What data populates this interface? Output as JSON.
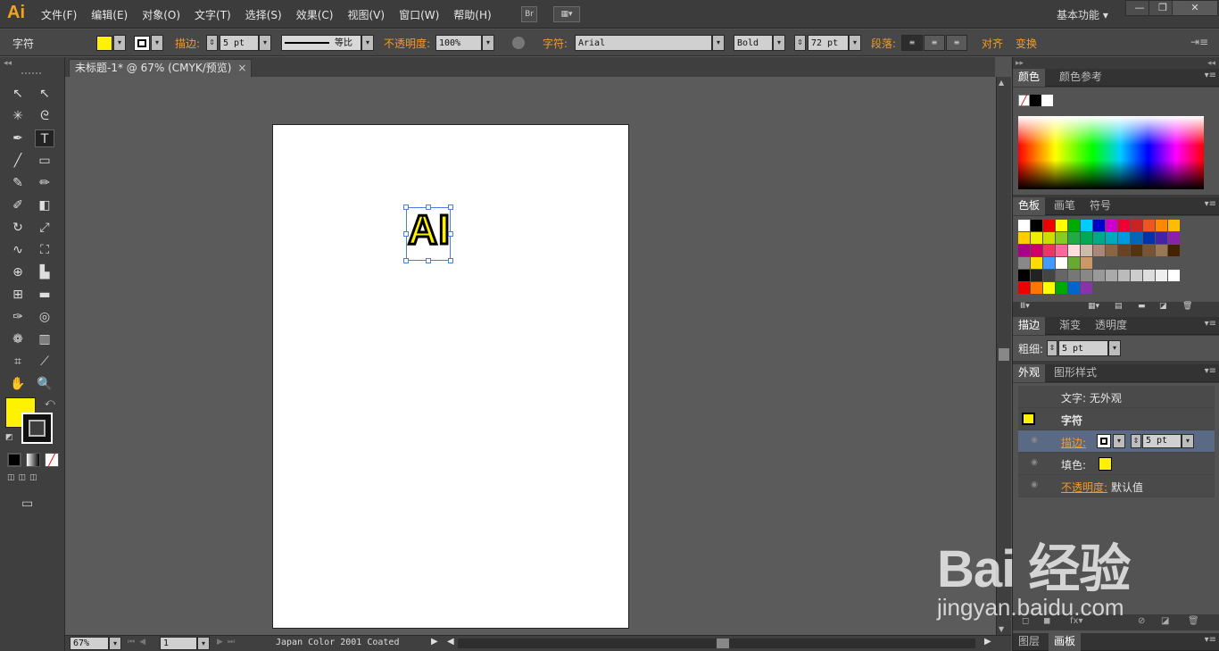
{
  "app": {
    "logo": "Ai"
  },
  "menu": [
    "文件(F)",
    "编辑(E)",
    "对象(O)",
    "文字(T)",
    "选择(S)",
    "效果(C)",
    "视图(V)",
    "窗口(W)",
    "帮助(H)"
  ],
  "menubar": {
    "bridge": "Br",
    "workspace": "基本功能 ▾"
  },
  "window_buttons": {
    "minimize": "—",
    "restore": "❐",
    "close": "✕"
  },
  "control": {
    "type_label": "字符",
    "stroke_label": "描边:",
    "stroke_value": "5 pt",
    "stroke_profile": "等比",
    "opacity_label": "不透明度:",
    "opacity_value": "100%",
    "char_label": "字符:",
    "font": "Arial",
    "style": "Bold",
    "size": "72 pt",
    "para_label": "段落:",
    "align_label": "对齐",
    "transform_label": "变换",
    "fill_color": "#fff200"
  },
  "document": {
    "tab_title": "未标题-1* @ 67% (CMYK/预览)",
    "close": "×",
    "art_text": "AI"
  },
  "status": {
    "zoom": "67%",
    "page": "1",
    "profile": "Japan Color 2001 Coated"
  },
  "panels": {
    "color_tabs": [
      "颜色",
      "颜色参考"
    ],
    "swatch_tabs": [
      "色板",
      "画笔",
      "符号"
    ],
    "stroke_tabs": [
      "描边",
      "渐变",
      "透明度"
    ],
    "weight_label": "粗细:",
    "weight_value": "5 pt",
    "appearance_tabs": [
      "外观",
      "图形样式"
    ],
    "appearance": {
      "header": "文字: 无外观",
      "char": "字符",
      "stroke_label": "描边:",
      "stroke_value": "5 pt",
      "fill_label": "填色:",
      "opacity_label": "不透明度:",
      "opacity_value": "默认值"
    },
    "bottom_tabs": [
      "图层",
      "画板"
    ]
  },
  "watermark": {
    "brand": "Bai 经验",
    "url": "jingyan.baidu.com"
  },
  "swatch_colors": [
    [
      "#fff",
      "#000",
      "#e00",
      "#ff0",
      "#0a0",
      "#0cf",
      "#00c",
      "#c0c",
      "#e03",
      "#c22",
      "#e52",
      "#f80",
      "#fb0"
    ],
    [
      "#fc0",
      "#ee0",
      "#cd0",
      "#8c2",
      "#2a4",
      "#0a5",
      "#0a8",
      "#0ab",
      "#09d",
      "#06b",
      "#03a",
      "#42a",
      "#82a"
    ],
    [
      "#a08",
      "#c06",
      "#e36",
      "#f69",
      "#fdd",
      "#cba",
      "#a87",
      "#864",
      "#642",
      "#531",
      "#753",
      "#975",
      "#420"
    ],
    [
      "#888",
      "#fd0",
      "#49f",
      "#fff",
      "#6a3",
      "#c96"
    ],
    [
      "#000",
      "#222",
      "#444",
      "#666",
      "#777",
      "#888",
      "#999",
      "#aaa",
      "#bbb",
      "#ccc",
      "#ddd",
      "#eee",
      "#fff"
    ],
    [
      "#e00",
      "#f70",
      "#ff0",
      "#0a0",
      "#06c",
      "#83a"
    ]
  ]
}
